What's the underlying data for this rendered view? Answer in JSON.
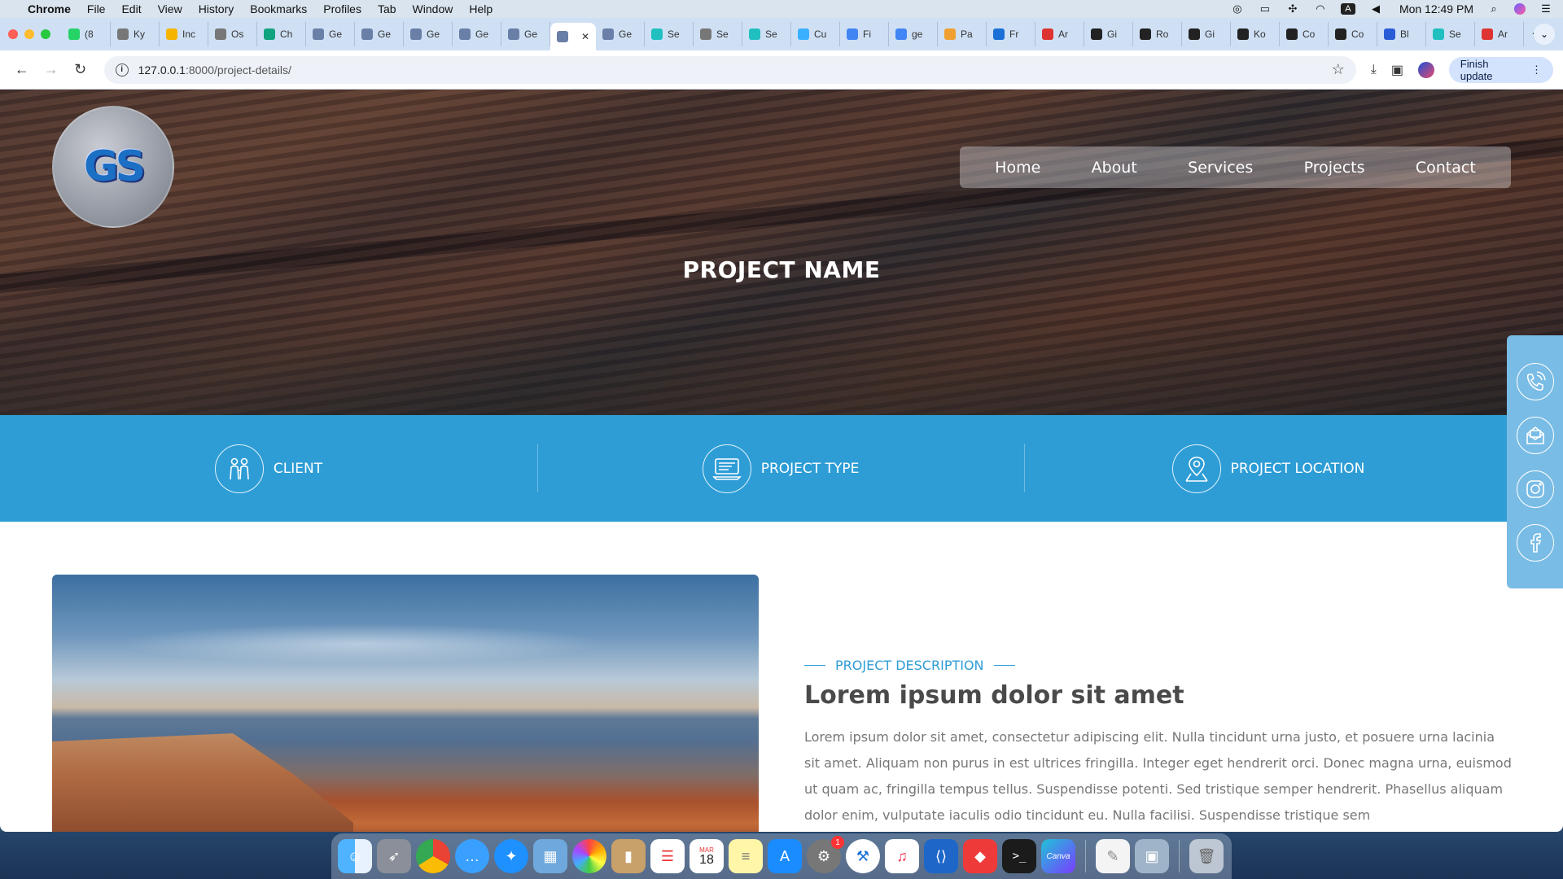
{
  "menubar": {
    "app": "Chrome",
    "items": [
      "File",
      "Edit",
      "View",
      "History",
      "Bookmarks",
      "Profiles",
      "Tab",
      "Window",
      "Help"
    ],
    "clock": "Mon 12:49 PM"
  },
  "tabs": [
    {
      "label": "(8",
      "fav": "whatsapp"
    },
    {
      "label": "Ky",
      "fav": "globe"
    },
    {
      "label": "Inc",
      "fav": "bolt"
    },
    {
      "label": "Os",
      "fav": "globe"
    },
    {
      "label": "Ch",
      "fav": "openai"
    },
    {
      "label": "Ge",
      "fav": "gs"
    },
    {
      "label": "Ge",
      "fav": "gs"
    },
    {
      "label": "Ge",
      "fav": "gs"
    },
    {
      "label": "Ge",
      "fav": "gs"
    },
    {
      "label": "Ge",
      "fav": "gs"
    },
    {
      "label": "",
      "fav": "gs",
      "active": true
    },
    {
      "label": "Ge",
      "fav": "gs"
    },
    {
      "label": "Se",
      "fav": "v"
    },
    {
      "label": "Se",
      "fav": "globe"
    },
    {
      "label": "Se",
      "fav": "v"
    },
    {
      "label": "Cu",
      "fav": "cu"
    },
    {
      "label": "Fi",
      "fav": "google"
    },
    {
      "label": "ge",
      "fav": "google"
    },
    {
      "label": "Pa",
      "fav": "pa"
    },
    {
      "label": "Fr",
      "fav": "ph"
    },
    {
      "label": "Ar",
      "fav": "ar"
    },
    {
      "label": "Gi",
      "fav": "gi"
    },
    {
      "label": "Ro",
      "fav": "ro"
    },
    {
      "label": "Gi",
      "fav": "gi"
    },
    {
      "label": "Ko",
      "fav": "ko"
    },
    {
      "label": "Co",
      "fav": "co"
    },
    {
      "label": "Co",
      "fav": "co"
    },
    {
      "label": "Bl",
      "fav": "bl"
    },
    {
      "label": "Se",
      "fav": "v"
    },
    {
      "label": "Ar",
      "fav": "ar"
    }
  ],
  "toolbar": {
    "url_host": "127.0.0.1",
    "url_path": ":8000/project-details/",
    "finish_update": "Finish update"
  },
  "site": {
    "logo_text": "GS",
    "nav": [
      "Home",
      "About",
      "Services",
      "Projects",
      "Contact"
    ],
    "hero_title": "PROJECT NAME",
    "info": [
      {
        "label": "CLIENT",
        "icon": "client-icon"
      },
      {
        "label": "PROJECT TYPE",
        "icon": "project-type-icon"
      },
      {
        "label": "PROJECT LOCATION",
        "icon": "location-icon"
      }
    ],
    "social": [
      "phone-icon",
      "mail-icon",
      "instagram-icon",
      "facebook-icon"
    ],
    "desc_label": "PROJECT DESCRIPTION",
    "desc_title": "Lorem ipsum dolor sit amet",
    "desc_body": "Lorem ipsum dolor sit amet, consectetur adipiscing elit. Nulla tincidunt urna justo, et posuere urna lacinia sit amet. Aliquam non purus in est ultrices fringilla. Integer eget hendrerit orci. Donec magna urna, euismod ut quam ac, fringilla tempus tellus. Suspendisse potenti. Sed tristique semper hendrerit. Phasellus aliquam dolor enim, vulputate iaculis odio tincidunt eu. Nulla facilisi. Suspendisse tristique sem"
  },
  "dock": {
    "calendar_month": "MAR",
    "calendar_day": "18",
    "settings_badge": "1",
    "canva": "Canva"
  },
  "colors": {
    "accent": "#2e9dd6",
    "side_panel": "#79bce5",
    "title_text": "#4a4a4a"
  }
}
